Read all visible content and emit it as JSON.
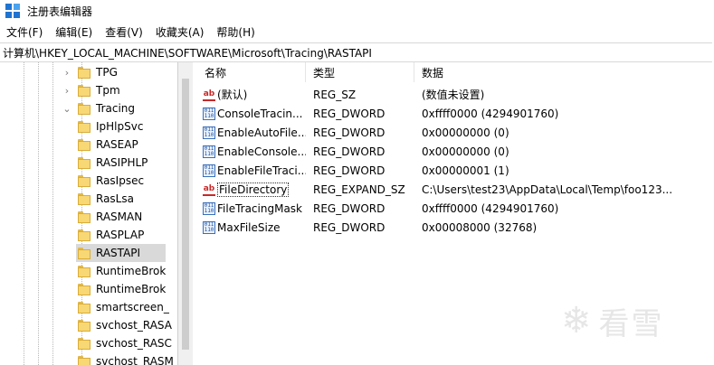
{
  "window": {
    "title": "注册表编辑器",
    "icon": "regedit-icon"
  },
  "menu": [
    {
      "label": "文件(F)"
    },
    {
      "label": "编辑(E)"
    },
    {
      "label": "查看(V)"
    },
    {
      "label": "收藏夹(A)"
    },
    {
      "label": "帮助(H)"
    }
  ],
  "address": "计算机\\HKEY_LOCAL_MACHINE\\SOFTWARE\\Microsoft\\Tracing\\RASTAPI",
  "tree": {
    "items": [
      {
        "label": "TPG",
        "expander": "›",
        "level": 0
      },
      {
        "label": "Tpm",
        "expander": "›",
        "level": 0
      },
      {
        "label": "Tracing",
        "expander": "⌄",
        "level": 0
      },
      {
        "label": "IpHlpSvc",
        "expander": "",
        "level": 1
      },
      {
        "label": "RASEAP",
        "expander": "",
        "level": 1
      },
      {
        "label": "RASIPHLP",
        "expander": "",
        "level": 1
      },
      {
        "label": "RasIpsec",
        "expander": "",
        "level": 1
      },
      {
        "label": "RasLsa",
        "expander": "",
        "level": 1
      },
      {
        "label": "RASMAN",
        "expander": "",
        "level": 1
      },
      {
        "label": "RASPLAP",
        "expander": "",
        "level": 1
      },
      {
        "label": "RASTAPI",
        "expander": "",
        "level": 1,
        "selected": true
      },
      {
        "label": "RuntimeBrok",
        "expander": "",
        "level": 1
      },
      {
        "label": "RuntimeBrok",
        "expander": "",
        "level": 1
      },
      {
        "label": "smartscreen_",
        "expander": "",
        "level": 1
      },
      {
        "label": "svchost_RASA",
        "expander": "",
        "level": 1
      },
      {
        "label": "svchost_RASC",
        "expander": "",
        "level": 1
      },
      {
        "label": "svchost_RASM",
        "expander": "",
        "level": 1
      }
    ]
  },
  "list": {
    "columns": [
      "名称",
      "类型",
      "数据"
    ],
    "rows": [
      {
        "icon": "string-value-icon",
        "icon_text": "ab",
        "name": "(默认)",
        "type": "REG_SZ",
        "data": "(数值未设置)"
      },
      {
        "icon": "binary-value-icon",
        "icon_text": "011\n110",
        "name": "ConsoleTracin...",
        "type": "REG_DWORD",
        "data": "0xffff0000 (4294901760)"
      },
      {
        "icon": "binary-value-icon",
        "icon_text": "011\n110",
        "name": "EnableAutoFile...",
        "type": "REG_DWORD",
        "data": "0x00000000 (0)"
      },
      {
        "icon": "binary-value-icon",
        "icon_text": "011\n110",
        "name": "EnableConsole...",
        "type": "REG_DWORD",
        "data": "0x00000000 (0)"
      },
      {
        "icon": "binary-value-icon",
        "icon_text": "011\n110",
        "name": "EnableFileTraci...",
        "type": "REG_DWORD",
        "data": "0x00000001 (1)"
      },
      {
        "icon": "string-value-icon",
        "icon_text": "ab",
        "name": "FileDirectory",
        "type": "REG_EXPAND_SZ",
        "data": "C:\\Users\\test23\\AppData\\Local\\Temp\\foo123...",
        "focused": true
      },
      {
        "icon": "binary-value-icon",
        "icon_text": "011\n110",
        "name": "FileTracingMask",
        "type": "REG_DWORD",
        "data": "0xffff0000 (4294901760)"
      },
      {
        "icon": "binary-value-icon",
        "icon_text": "011\n110",
        "name": "MaxFileSize",
        "type": "REG_DWORD",
        "data": "0x00008000 (32768)"
      }
    ]
  },
  "watermark": {
    "icon": "snowflake-icon",
    "text": "看雪"
  }
}
